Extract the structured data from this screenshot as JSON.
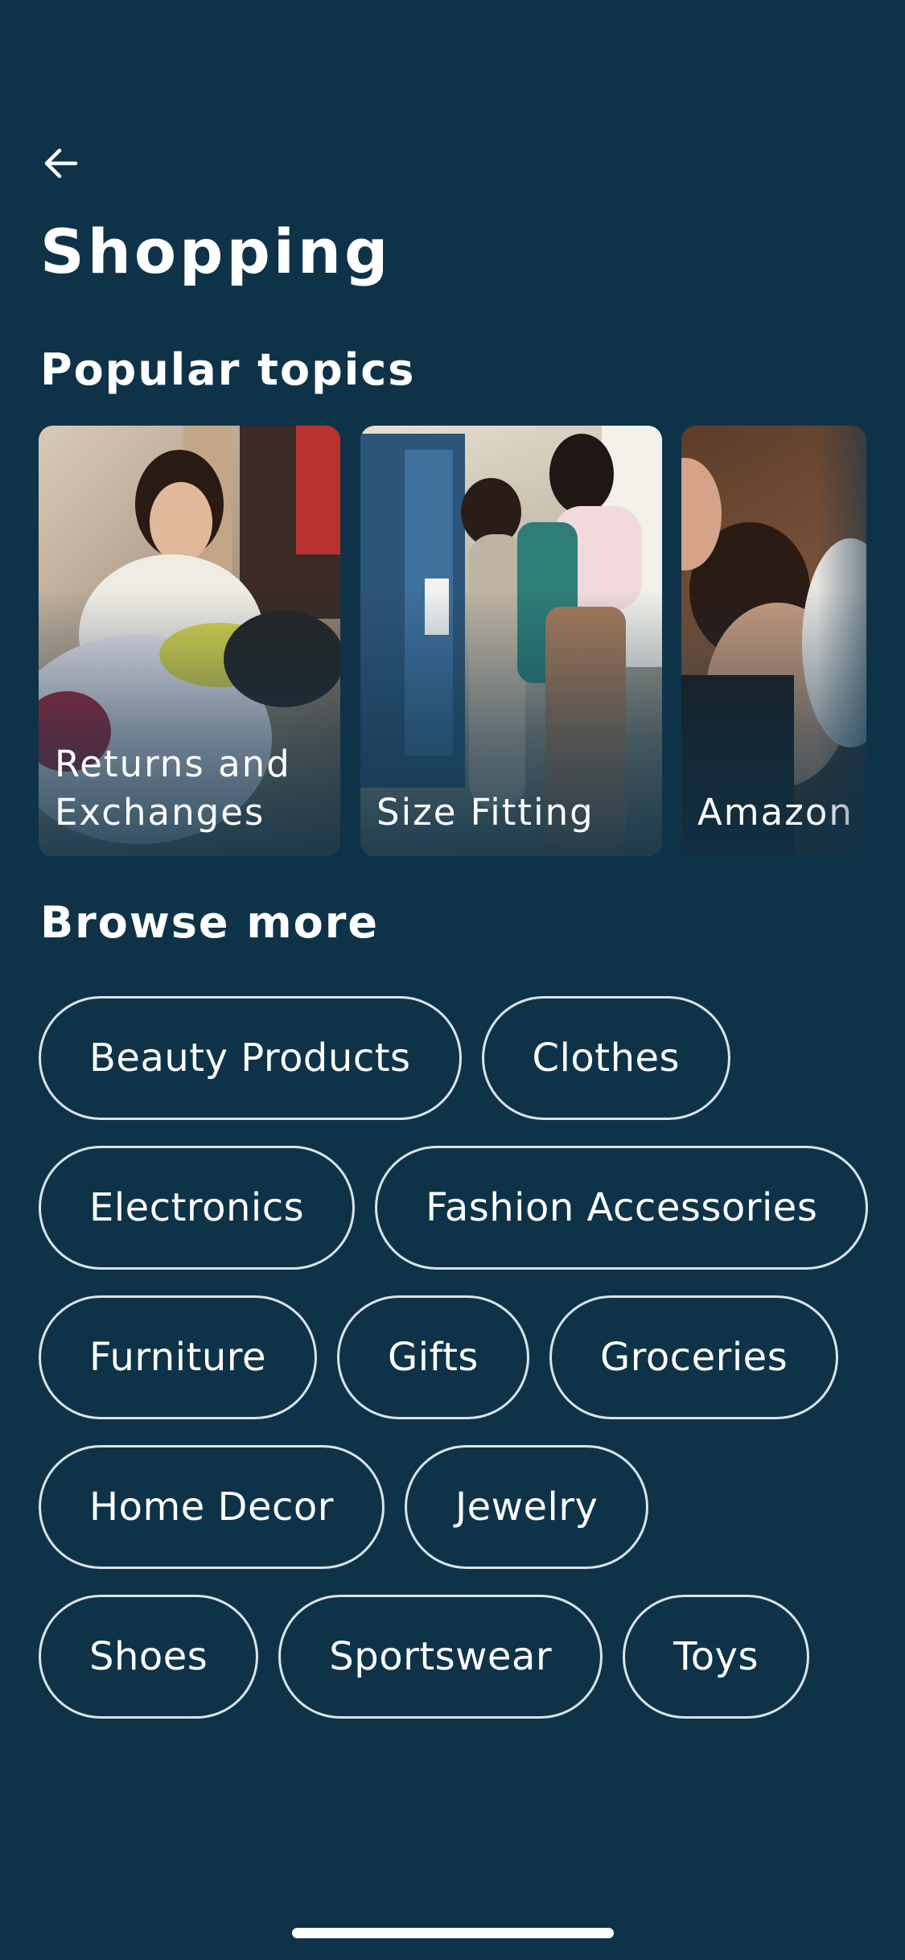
{
  "header": {
    "back_icon": "arrow-left-icon",
    "title": "Shopping"
  },
  "popular": {
    "heading": "Popular topics",
    "topics": [
      {
        "label": "Returns and Exchanges"
      },
      {
        "label": "Size Fitting"
      },
      {
        "label": "Amazon"
      }
    ]
  },
  "browse": {
    "heading": "Browse more",
    "chips": [
      "Beauty Products",
      "Clothes",
      "Electronics",
      "Fashion Accessories",
      "Furniture",
      "Gifts",
      "Groceries",
      "Home Decor",
      "Jewelry",
      "Shoes",
      "Sportswear",
      "Toys"
    ]
  },
  "colors": {
    "background": "#0e3349",
    "text": "#ffffff",
    "chip_border": "#d9e4ea"
  }
}
